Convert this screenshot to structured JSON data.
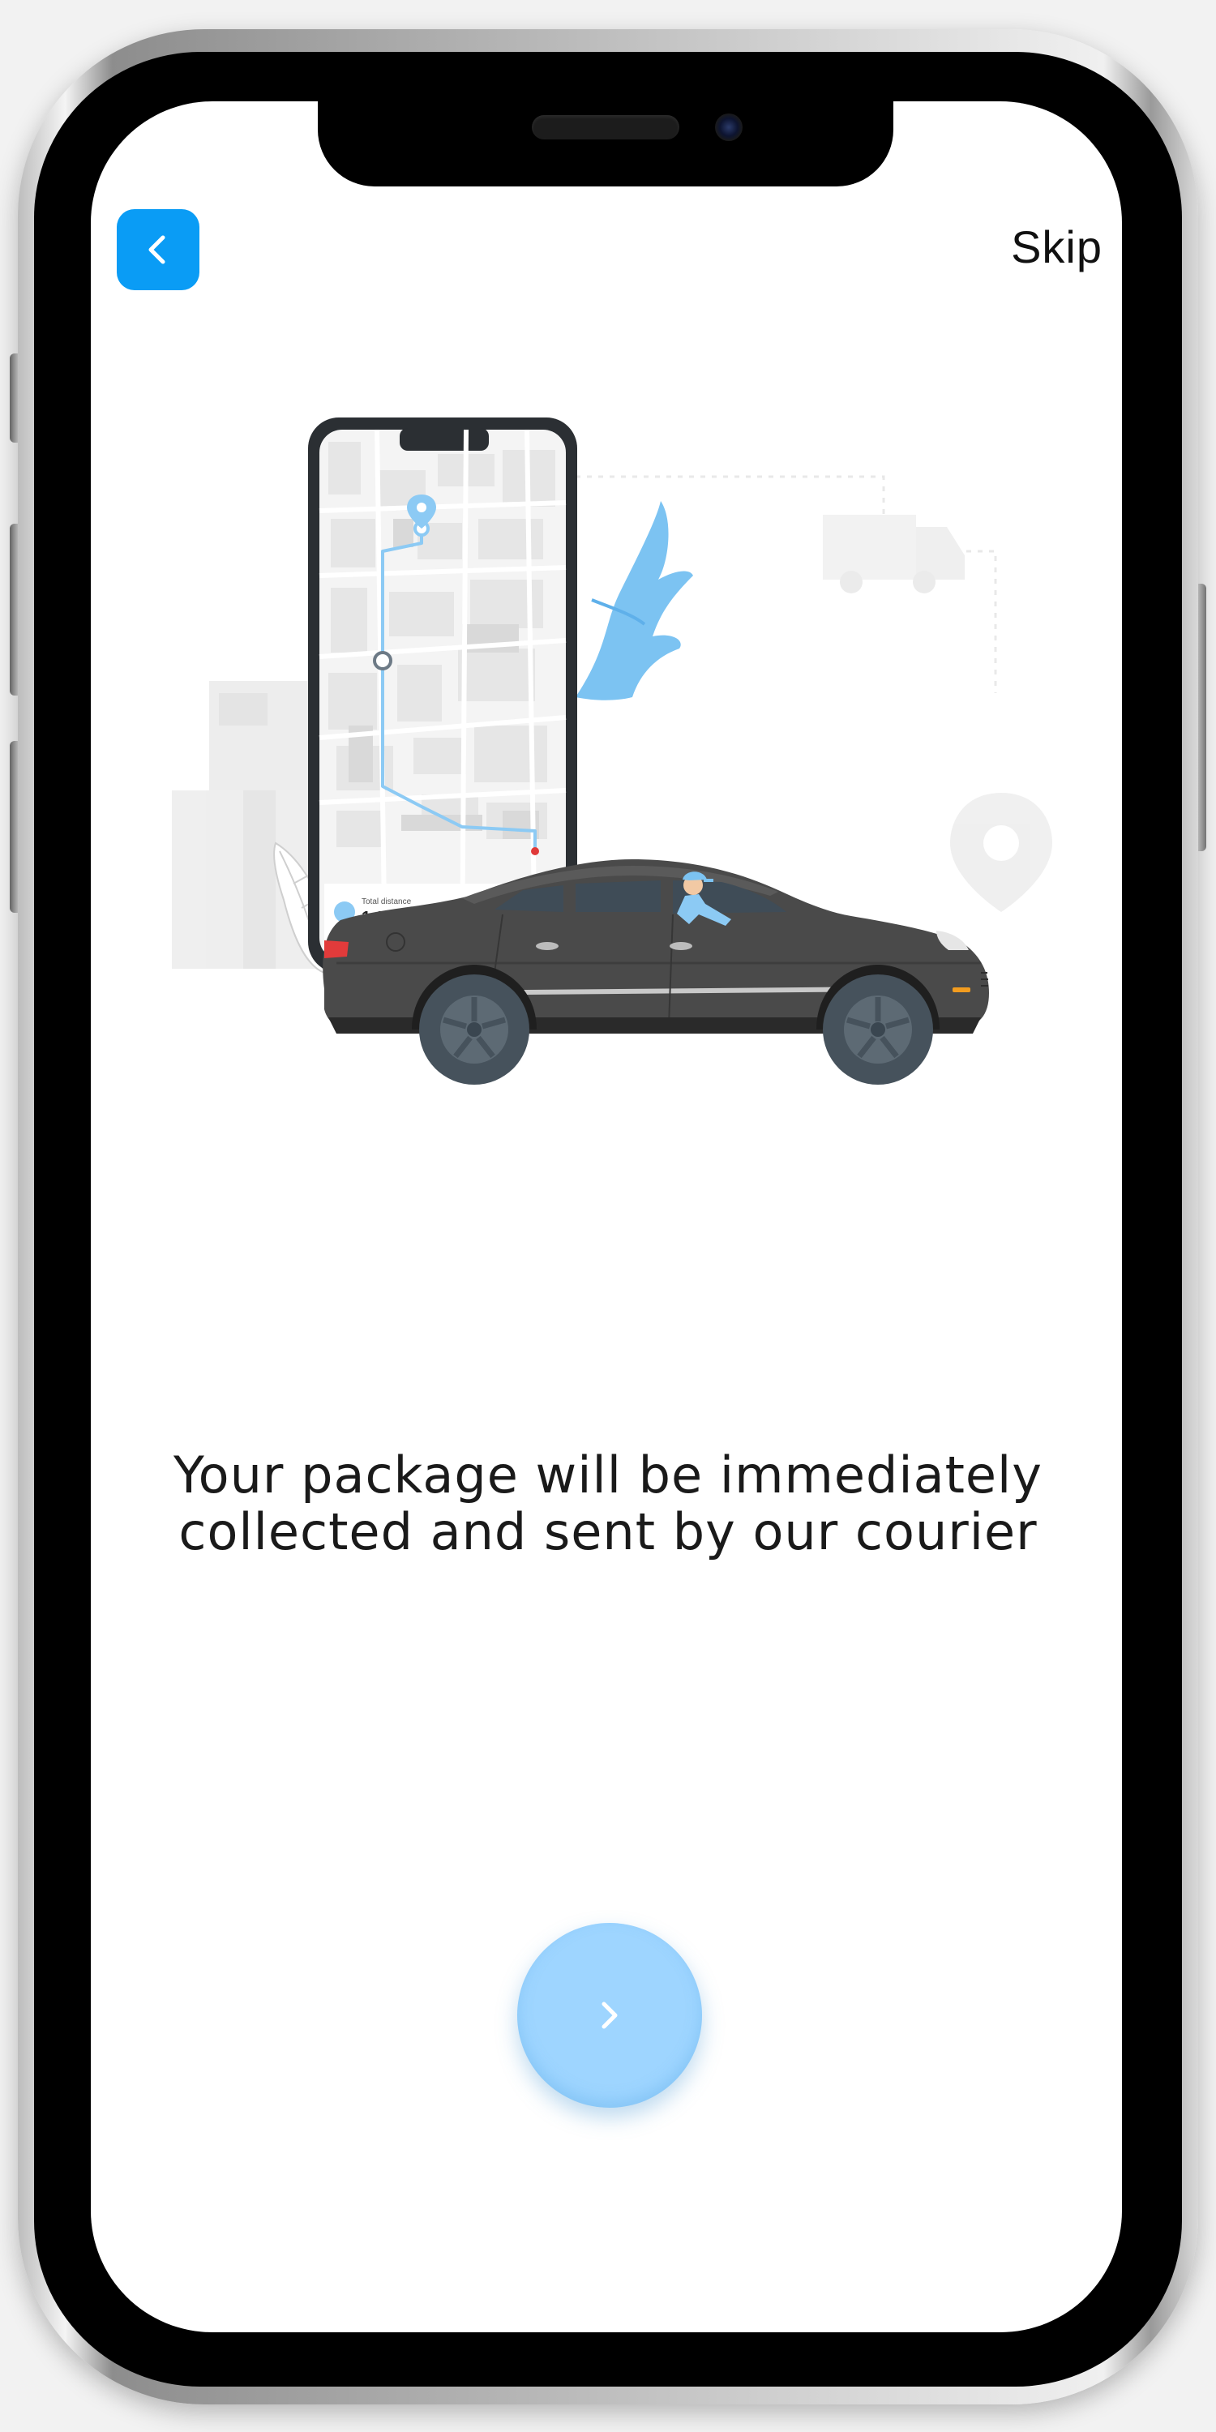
{
  "header": {
    "back_icon": "chevron-left-icon",
    "skip_label": "Skip"
  },
  "illustration": {
    "phone_screen": {
      "distance_label": "Total distance",
      "distance_value": "1,100 m"
    }
  },
  "onboarding": {
    "message_line1": "Your package will be immediately",
    "message_line2": "collected and sent by our courier"
  },
  "footer": {
    "next_icon": "chevron-right-icon"
  },
  "colors": {
    "accent": "#0a9cf5",
    "next_button": "#9ed5ff",
    "route": "#8ccaf4",
    "car_body": "#4a4a4a",
    "text": "#1a1a1a"
  }
}
